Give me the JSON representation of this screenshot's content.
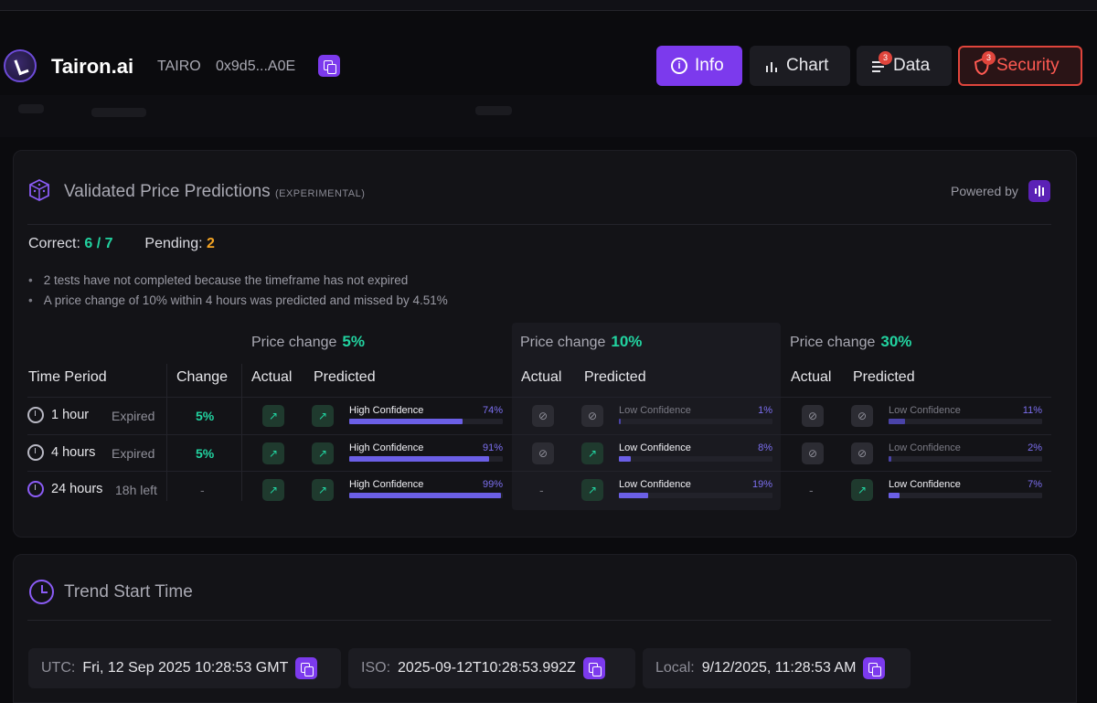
{
  "header": {
    "brand": "Tairon.ai",
    "ticker": "TAIRO",
    "address": "0x9d5...A0E",
    "nav": {
      "info": "Info",
      "chart": "Chart",
      "data": "Data",
      "data_badge": "3",
      "security": "Security",
      "security_badge": "3"
    }
  },
  "predictions": {
    "title": "Validated Price Predictions",
    "title_tag": "(EXPERIMENTAL)",
    "powered_by": "Powered by",
    "correct_label": "Correct:",
    "correct_value": "6 / 7",
    "pending_label": "Pending:",
    "pending_value": "2",
    "notes": [
      "2 tests have not completed because the timeframe has not expired",
      "A price change of 10% within 4 hours was predicted and missed by 4.51%"
    ],
    "groups": [
      {
        "label": "Price change",
        "value": "5%"
      },
      {
        "label": "Price change",
        "value": "10%"
      },
      {
        "label": "Price change",
        "value": "30%"
      }
    ],
    "columns": {
      "time_period": "Time Period",
      "change": "Change",
      "actual": "Actual",
      "predicted": "Predicted"
    },
    "rows": [
      {
        "period": "1 hour",
        "status": "Expired",
        "change": "5%",
        "p5": {
          "actual": "up",
          "pred": "up",
          "conf": "High Confidence",
          "pct": "74%",
          "frac": 0.74
        },
        "p10": {
          "actual": "none",
          "pred": "none",
          "conf": "Low Confidence",
          "pct": "1%",
          "frac": 0.01
        },
        "p30": {
          "actual": "none",
          "pred": "none",
          "conf": "Low Confidence",
          "pct": "11%",
          "frac": 0.11
        }
      },
      {
        "period": "4 hours",
        "status": "Expired",
        "change": "5%",
        "p5": {
          "actual": "up",
          "pred": "up",
          "conf": "High Confidence",
          "pct": "91%",
          "frac": 0.91
        },
        "p10": {
          "actual": "none",
          "pred": "up",
          "conf": "Low Confidence",
          "pct": "8%",
          "frac": 0.08
        },
        "p30": {
          "actual": "none",
          "pred": "none",
          "conf": "Low Confidence",
          "pct": "2%",
          "frac": 0.02
        }
      },
      {
        "period": "24 hours",
        "status": "18h left",
        "change": "-",
        "p5": {
          "actual": "up",
          "pred": "up",
          "conf": "High Confidence",
          "pct": "99%",
          "frac": 0.99
        },
        "p10": {
          "actual": "-",
          "pred": "up",
          "conf": "Low Confidence",
          "pct": "19%",
          "frac": 0.19
        },
        "p30": {
          "actual": "-",
          "pred": "up",
          "conf": "Low Confidence",
          "pct": "7%",
          "frac": 0.07
        }
      }
    ]
  },
  "trend": {
    "title": "Trend Start Time",
    "utc_label": "UTC:",
    "utc_value": "Fri, 12 Sep 2025 10:28:53 GMT",
    "iso_label": "ISO:",
    "iso_value": "2025-09-12T10:28:53.992Z",
    "local_label": "Local:",
    "local_value": "9/12/2025, 11:28:53 AM"
  },
  "colors": {
    "accent": "#7c3aed",
    "positive": "#22d3a0",
    "pending": "#f5a524",
    "danger": "#e0453c",
    "bar": "#6b5fe6"
  },
  "icons": [
    "info-icon",
    "bar-chart-icon",
    "list-icon",
    "shield-icon",
    "copy-icon",
    "cube-icon",
    "clock-icon",
    "trend-up-icon",
    "circle-slash-icon"
  ]
}
